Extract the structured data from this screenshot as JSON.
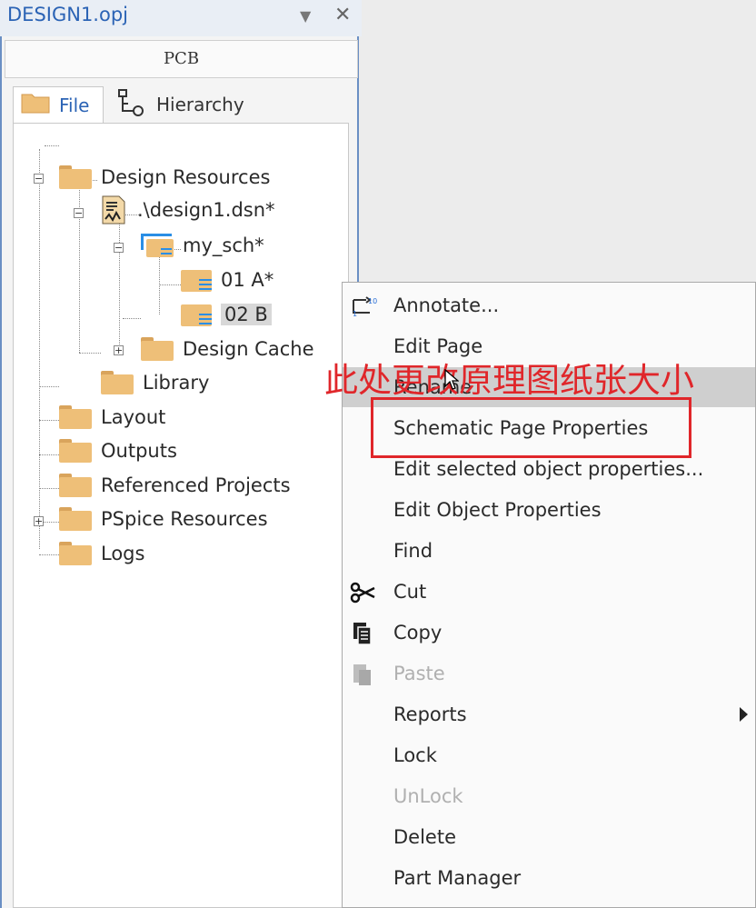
{
  "window": {
    "title": "DESIGN1.opj",
    "dropdown_icon": "chevron-down-icon",
    "close_icon": "close-icon"
  },
  "panel": {
    "header": "PCB",
    "tabs": [
      {
        "label": "File",
        "icon": "folder-icon",
        "active": true
      },
      {
        "label": "Hierarchy",
        "icon": "hierarchy-icon",
        "active": false
      }
    ]
  },
  "tree": {
    "design_resources": "Design Resources",
    "design_file": ".\\design1.dsn*",
    "schematic": "my_sch*",
    "page1": "01 A*",
    "page2": "02 B",
    "design_cache": "Design Cache",
    "library": "Library",
    "layout": "Layout",
    "outputs": "Outputs",
    "referenced_projects": "Referenced Projects",
    "pspice_resources": "PSpice Resources",
    "logs": "Logs"
  },
  "context_menu": {
    "items": [
      {
        "label": "Annotate...",
        "icon": "annotate-icon"
      },
      {
        "label": "Edit Page"
      },
      {
        "label": "Rename",
        "highlighted": true
      },
      {
        "label": "Schematic Page Properties"
      },
      {
        "label": "Edit selected object properties..."
      },
      {
        "label": "Edit Object Properties"
      },
      {
        "label": "Find"
      },
      {
        "label": "Cut",
        "icon": "scissors-icon"
      },
      {
        "label": "Copy",
        "icon": "copy-icon"
      },
      {
        "label": "Paste",
        "icon": "paste-icon",
        "disabled": true
      },
      {
        "label": "Reports",
        "submenu": true
      },
      {
        "label": "Lock"
      },
      {
        "label": "UnLock",
        "disabled": true
      },
      {
        "label": "Delete"
      },
      {
        "label": "Part Manager"
      }
    ]
  },
  "annotation": {
    "text": "此处更改原理图纸张大小",
    "color": "#e0262a"
  },
  "colors": {
    "accent": "#2b63b5",
    "folder": "#eebf78",
    "selection": "#d8d8d8",
    "annotation_red": "#e0262a"
  }
}
